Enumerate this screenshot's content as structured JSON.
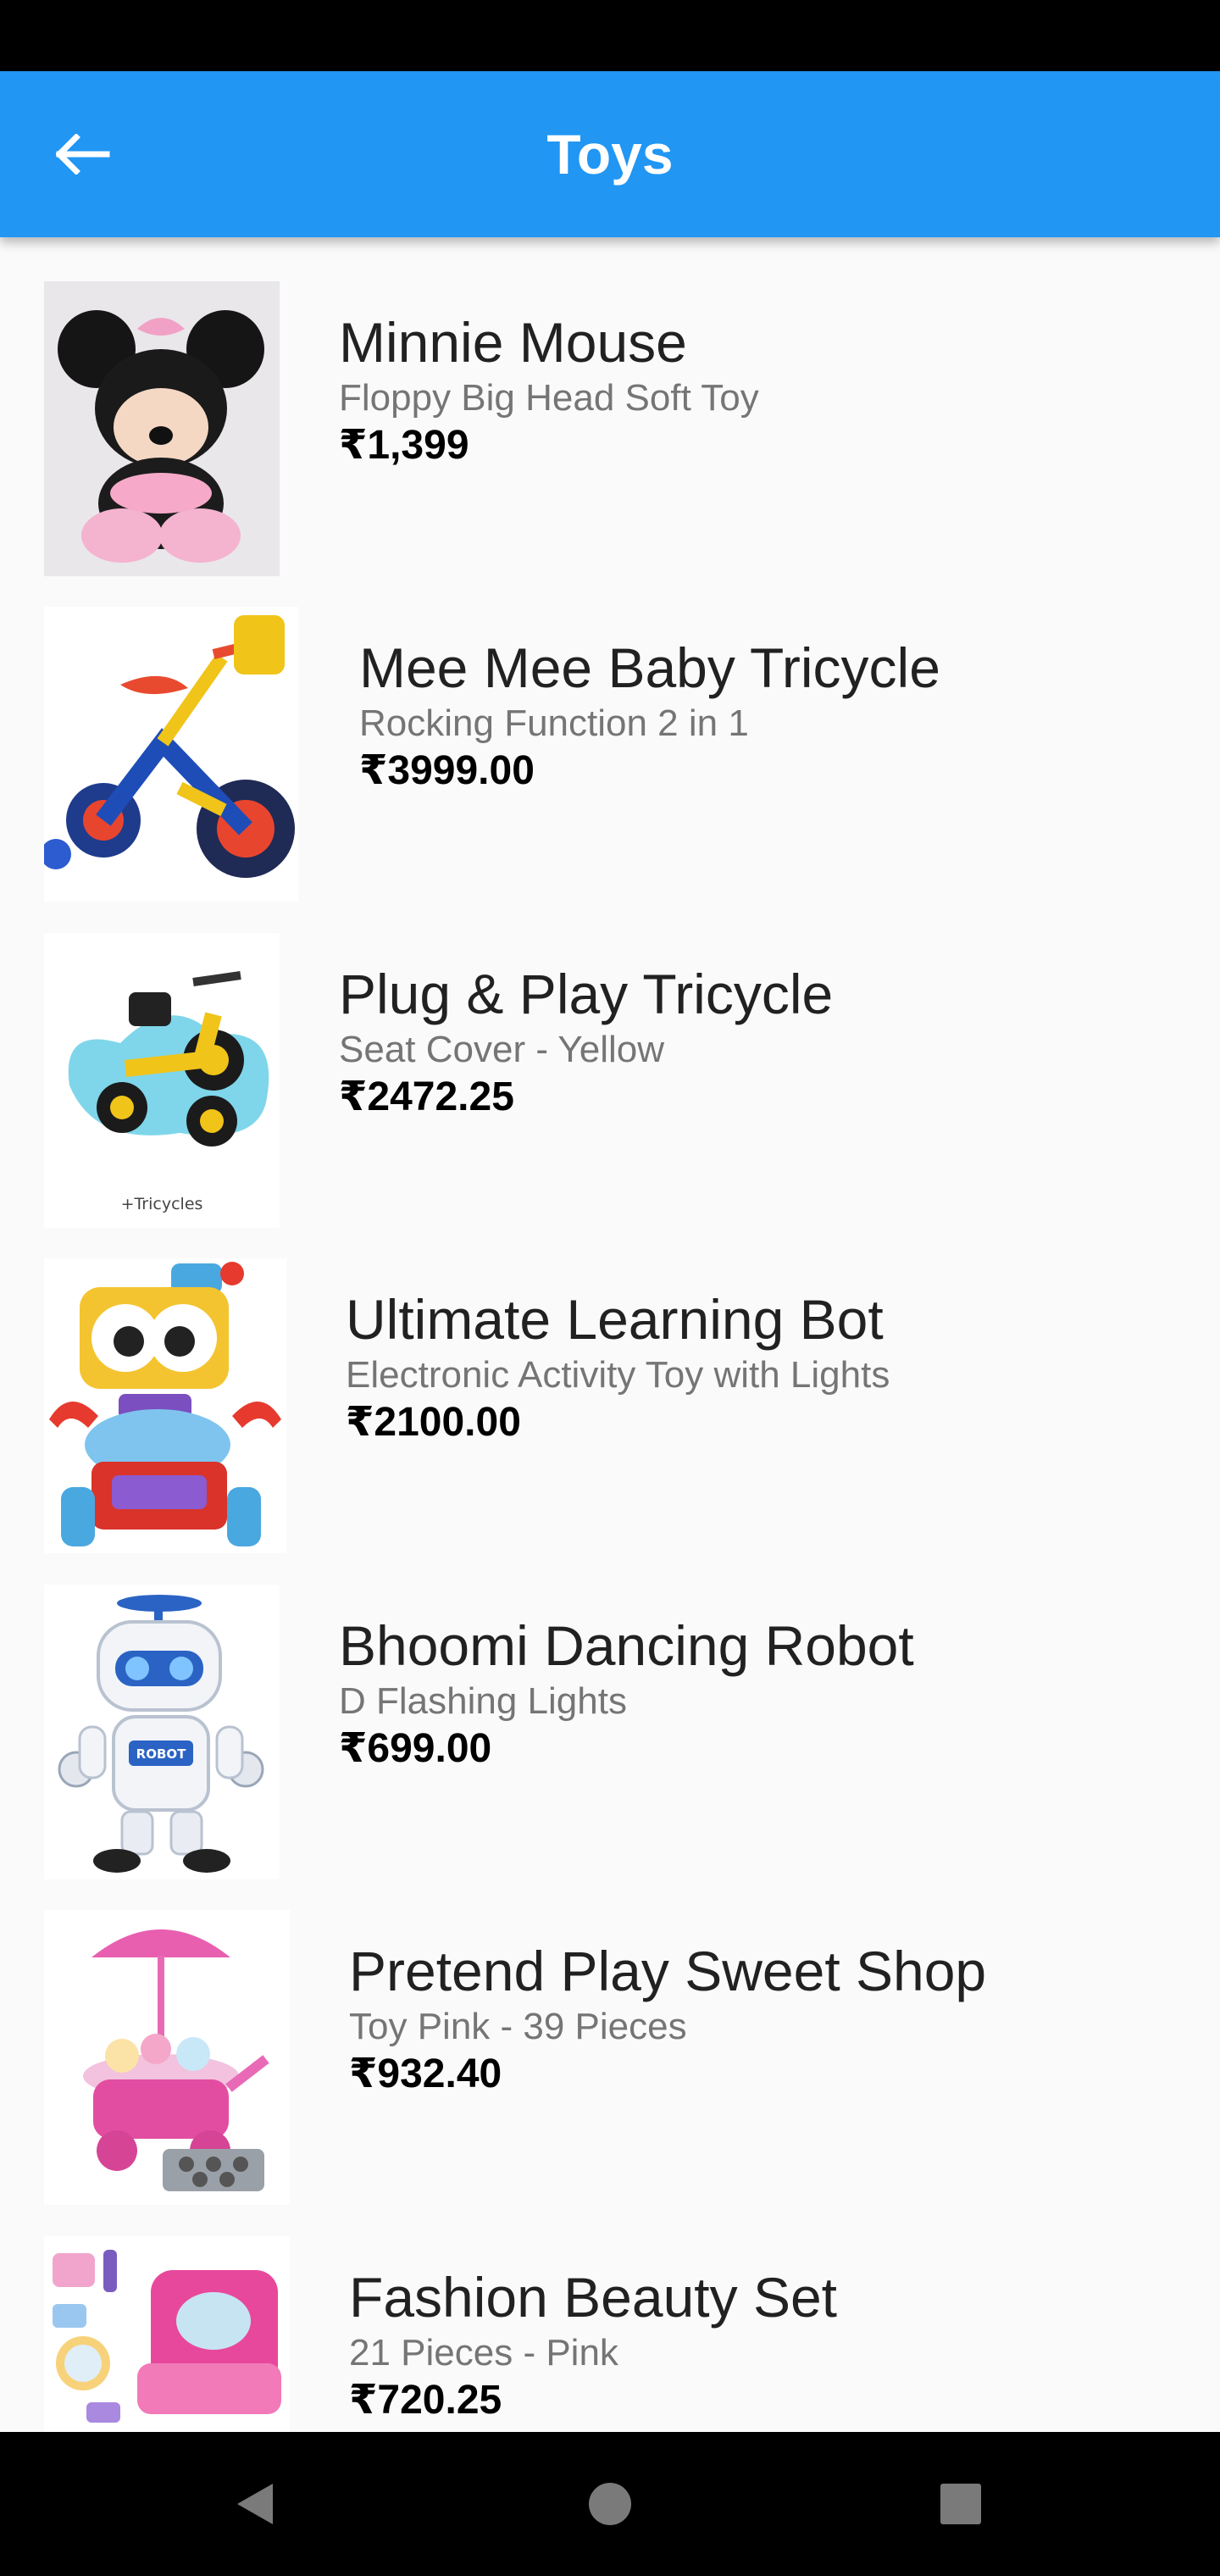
{
  "app_bar": {
    "title": "Toys",
    "back_icon": "arrow-back-icon"
  },
  "products": [
    {
      "name": "Minnie Mouse",
      "description": "Floppy Big Head Soft Toy",
      "price": "₹1,399",
      "image": "minnie-mouse-plush"
    },
    {
      "name": "Mee Mee Baby Tricycle",
      "description": "Rocking Function 2 in 1",
      "price": "₹3999.00",
      "image": "kids-bicycle"
    },
    {
      "name": "Plug & Play Tricycle",
      "description": " Seat Cover - Yellow",
      "price": "₹2472.25",
      "image": "yellow-tricycle",
      "image_caption": "+Tricycles"
    },
    {
      "name": "Ultimate Learning Bot",
      "description": "Electronic Activity Toy with Lights",
      "price": "₹2100.00",
      "image": "learning-robot"
    },
    {
      "name": "Bhoomi Dancing Robot",
      "description": "D Flashing Lights",
      "price": "₹699.00",
      "image": "dancing-robot",
      "image_label": "ROBOT"
    },
    {
      "name": "Pretend Play Sweet Shop",
      "description": "Toy Pink - 39 Pieces",
      "price": "₹932.40",
      "image": "sweet-shop-cart"
    },
    {
      "name": "Fashion Beauty Set",
      "description": "21 Pieces - Pink",
      "price": "₹720.25",
      "image": "beauty-set"
    }
  ],
  "nav_bar": {
    "back": "nav-back-icon",
    "home": "nav-home-icon",
    "recents": "nav-recents-icon"
  },
  "colors": {
    "app_bar": "#2196f3",
    "background": "#fafafa",
    "title_text": "#ffffff",
    "description_text": "#757575"
  }
}
